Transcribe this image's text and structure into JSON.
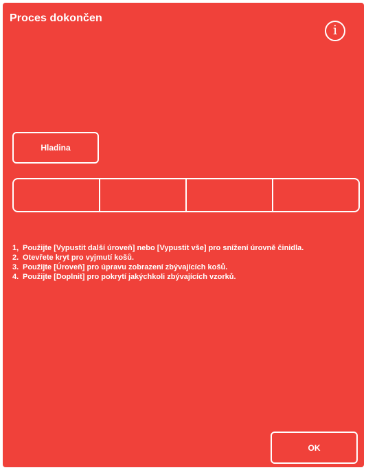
{
  "header": {
    "title": "Proces dokončen",
    "info_icon": "info-icon",
    "info_glyph": "i"
  },
  "level_button": {
    "label": "Hladina"
  },
  "basket_bar": {
    "slots": [
      "",
      "",
      "",
      ""
    ]
  },
  "instructions": [
    {
      "num": "1,",
      "text": "Použijte [Vypustit další úroveň] nebo [Vypustit vše] pro snížení úrovně činidla."
    },
    {
      "num": "2.",
      "text": "Otevřete kryt pro vyjmutí košů."
    },
    {
      "num": "3.",
      "text": "Použijte [Úroveň] pro úpravu zobrazení zbývajících košů."
    },
    {
      "num": "4.",
      "text": "Použijte [Doplnit] pro pokrytí jakýchkoli zbývajících vzorků."
    }
  ],
  "footer": {
    "ok_label": "OK"
  },
  "colors": {
    "background": "#f0413a",
    "foreground": "#ffffff"
  }
}
